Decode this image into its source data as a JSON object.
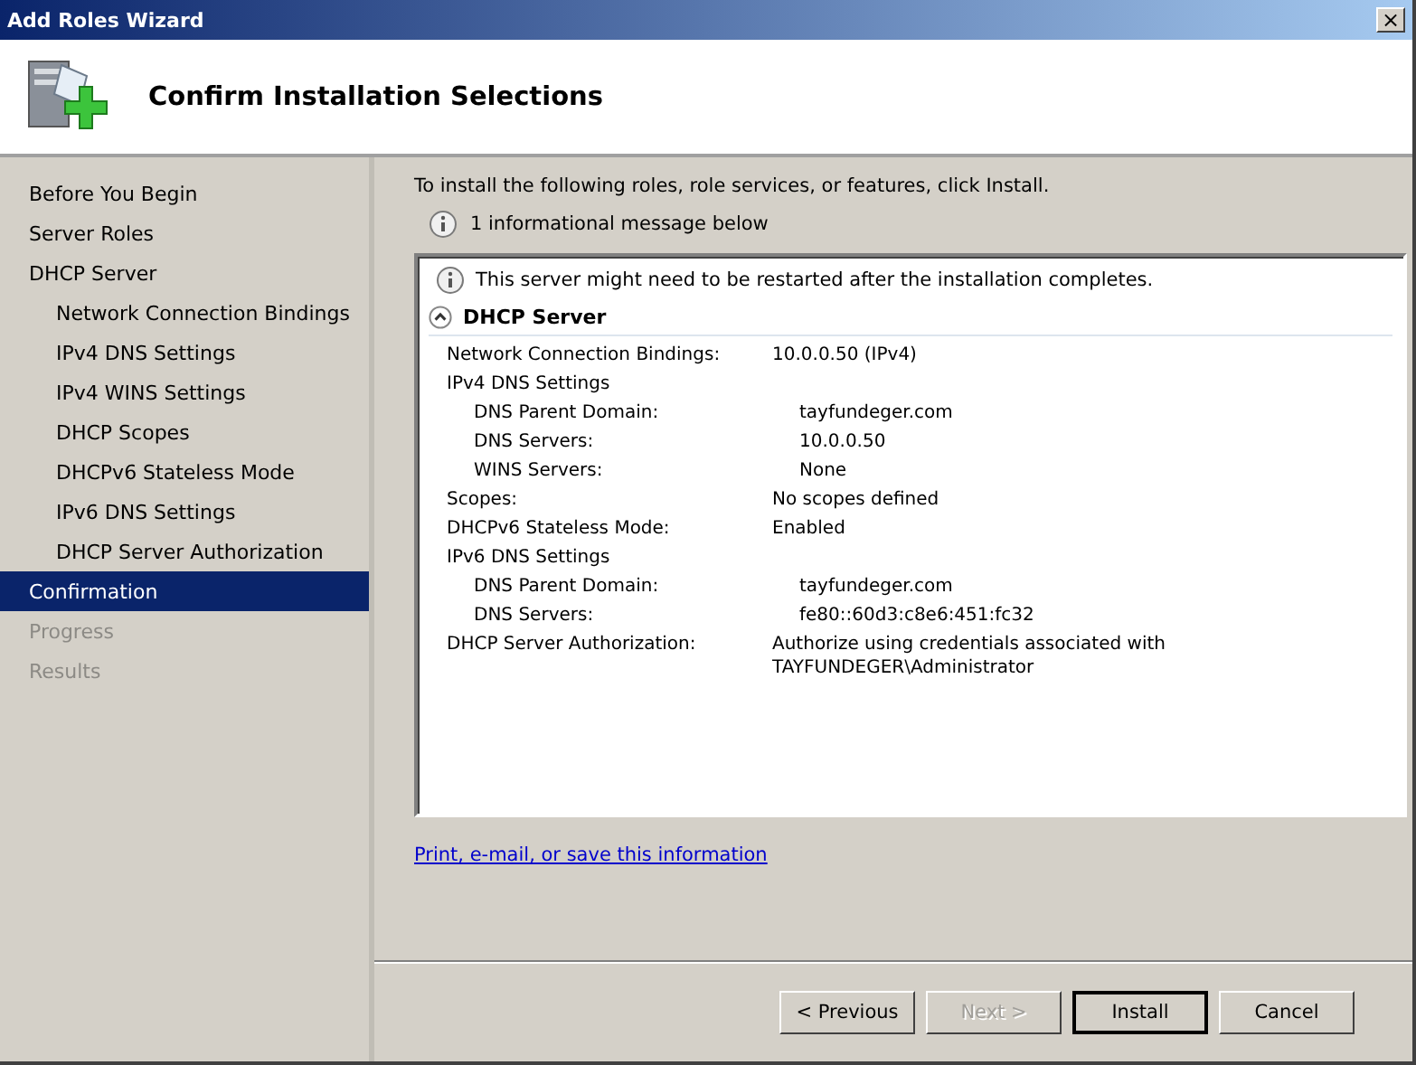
{
  "window": {
    "title": "Add Roles Wizard",
    "close": "×"
  },
  "header": {
    "title": "Confirm Installation Selections"
  },
  "nav": [
    {
      "label": "Before You Begin",
      "selected": false,
      "disabled": false
    },
    {
      "label": "Server Roles",
      "selected": false,
      "disabled": false
    },
    {
      "label": "DHCP Server",
      "selected": false,
      "disabled": false,
      "children": [
        {
          "label": "Network Connection Bindings",
          "selected": false,
          "disabled": false
        },
        {
          "label": "IPv4 DNS Settings",
          "selected": false,
          "disabled": false
        },
        {
          "label": "IPv4 WINS Settings",
          "selected": false,
          "disabled": false
        },
        {
          "label": "DHCP Scopes",
          "selected": false,
          "disabled": false
        },
        {
          "label": "DHCPv6 Stateless Mode",
          "selected": false,
          "disabled": false
        },
        {
          "label": "IPv6 DNS Settings",
          "selected": false,
          "disabled": false
        },
        {
          "label": "DHCP Server Authorization",
          "selected": false,
          "disabled": false
        }
      ]
    },
    {
      "label": "Confirmation",
      "selected": true,
      "disabled": false
    },
    {
      "label": "Progress",
      "selected": false,
      "disabled": true
    },
    {
      "label": "Results",
      "selected": false,
      "disabled": true
    }
  ],
  "instruction": "To install the following roles, role services, or features, click Install.",
  "info_summary": "1 informational message below",
  "details": {
    "message": "This server might need to be restarted after the installation completes.",
    "section": {
      "title": "DHCP Server",
      "expanded": true,
      "rows": [
        {
          "label": "Network Connection Bindings:",
          "value": "10.0.0.50 (IPv4)"
        },
        {
          "label": "IPv4 DNS Settings",
          "children": [
            {
              "label": "DNS Parent Domain:",
              "value": "tayfundeger.com"
            },
            {
              "label": "DNS Servers:",
              "value": "10.0.0.50"
            },
            {
              "label": "WINS Servers:",
              "value": "None"
            }
          ]
        },
        {
          "label": "Scopes:",
          "value": "No scopes defined"
        },
        {
          "label": "DHCPv6 Stateless Mode:",
          "value": "Enabled"
        },
        {
          "label": "IPv6 DNS Settings",
          "children": [
            {
              "label": "DNS Parent Domain:",
              "value": "tayfundeger.com"
            },
            {
              "label": "DNS Servers:",
              "value": "fe80::60d3:c8e6:451:fc32"
            }
          ]
        },
        {
          "label": "DHCP Server Authorization:",
          "value": "Authorize using credentials associated with TAYFUNDEGER\\Administrator"
        }
      ]
    }
  },
  "link": "Print, e-mail, or save this information",
  "buttons": [
    {
      "label": "< Previous",
      "disabled": false,
      "default": false
    },
    {
      "label": "Next >",
      "disabled": true,
      "default": false
    },
    {
      "label": "Install",
      "disabled": false,
      "default": true
    },
    {
      "label": "Cancel",
      "disabled": false,
      "default": false
    }
  ]
}
